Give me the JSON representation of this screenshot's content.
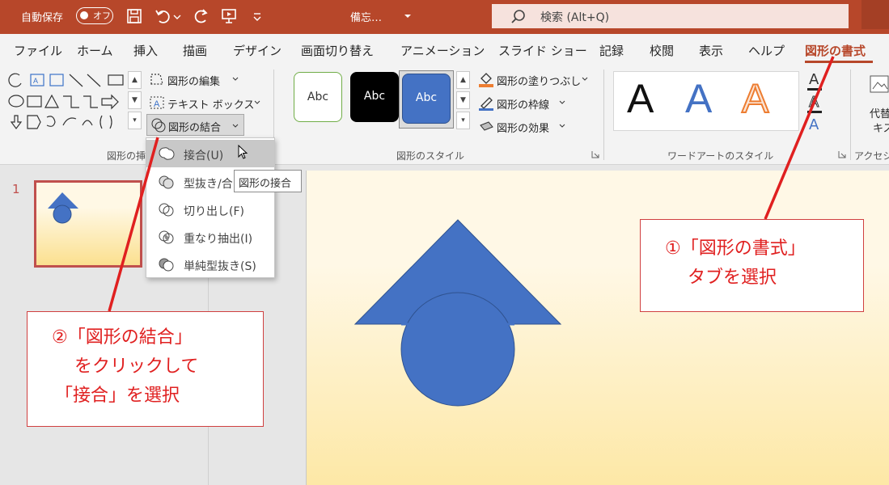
{
  "titlebar": {
    "autosave_label": "自動保存",
    "autosave_state": "オフ",
    "doc_title": "備忘…",
    "search_placeholder": "検索 (Alt+Q)",
    "accent_color": "#b7472a"
  },
  "tabs": {
    "file": "ファイル",
    "home": "ホーム",
    "insert": "挿入",
    "draw": "描画",
    "design": "デザイン",
    "transitions": "画面切り替え",
    "animations": "アニメーション",
    "slideshow": "スライド ショー",
    "record": "記録",
    "review": "校閲",
    "view": "表示",
    "help": "ヘルプ",
    "shape_format": "図形の書式"
  },
  "ribbon": {
    "insert_shapes": {
      "edit_shape": "図形の編集",
      "text_box": "テキスト ボックス",
      "merge_shapes": "図形の結合",
      "group_label": "図形の挿"
    },
    "shape_styles": {
      "thumb_labels": [
        "Abc",
        "Abc",
        "Abc"
      ],
      "fill": "図形の塗りつぶし",
      "outline": "図形の枠線",
      "effects": "図形の効果",
      "group_label": "図形のスタイル"
    },
    "wordart": {
      "letters": [
        "A",
        "A",
        "A"
      ],
      "group_label": "ワードアートのスタイル"
    },
    "accessibility": {
      "alt_text_line1": "代替",
      "alt_text_line2": "キス",
      "group_label": "アクセシビ"
    }
  },
  "merge_menu": {
    "items": [
      "接合(U)",
      "型抜き/合",
      "切り出し(F)",
      "重なり抽出(I)",
      "単純型抜き(S)"
    ],
    "tooltip": "図形の接合"
  },
  "slides_pane": {
    "slide_number": "1"
  },
  "callouts": {
    "tab_callout": [
      "①「図形の書式」",
      "タブを選択"
    ],
    "merge_callout": [
      "②「図形の結合」",
      "をクリックして",
      "「接合」を選択"
    ]
  },
  "colors": {
    "shape_blue": "#4472c4",
    "callout_red": "#e02020"
  }
}
